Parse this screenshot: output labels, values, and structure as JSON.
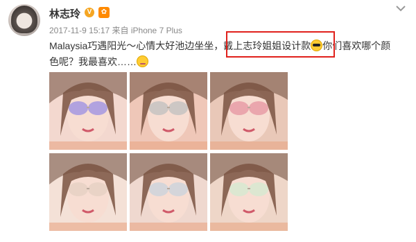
{
  "post": {
    "username": "林志玲",
    "verified_badge": "V",
    "member_badge": "✿",
    "timestamp": "2017-11-9 15:17",
    "source": "来自 iPhone 7 Plus",
    "text_part1": "Malaysia巧遇阳光～心情大好池边坐坐，",
    "text_highlight": "戴上志玲姐姐设计款",
    "text_part2": "你们喜欢哪个颜",
    "text_part3": "色呢？我最喜欢……",
    "highlight_color": "#e0201b"
  },
  "icons": {
    "avatar": "avatar",
    "verified": "verified-icon",
    "member": "member-icon",
    "menu": "chevron-down-icon",
    "emoji1": "sunglasses-emoji-icon",
    "emoji2": "shy-emoji-icon"
  },
  "photos": [
    {
      "name": "photo-1",
      "lens": "#a99be0",
      "bg": "#f3d8cf"
    },
    {
      "name": "photo-2",
      "lens": "#c8c4c2",
      "bg": "#efc7b8"
    },
    {
      "name": "photo-3",
      "lens": "#e8a0a8",
      "bg": "#e9c8b8"
    },
    {
      "name": "photo-4",
      "lens": "#e7d2c4",
      "bg": "#f4e1d7"
    },
    {
      "name": "photo-5",
      "lens": "#cfd4da",
      "bg": "#efd8cf"
    },
    {
      "name": "photo-6",
      "lens": "#d8e8d0",
      "bg": "#eed6c8"
    }
  ]
}
